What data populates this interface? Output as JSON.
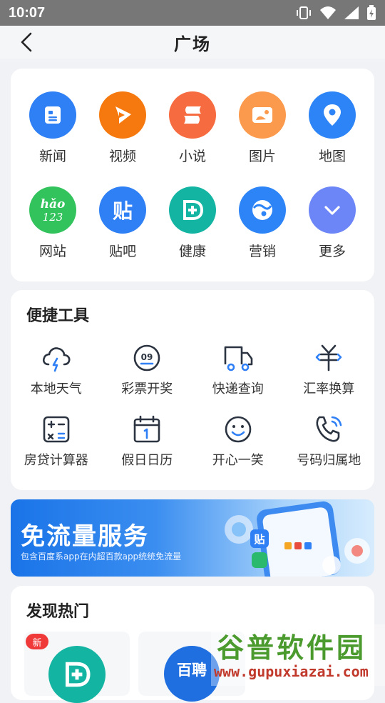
{
  "status_bar": {
    "time": "10:07"
  },
  "header": {
    "title": "广场"
  },
  "apps": [
    {
      "label": "新闻",
      "icon": "news-icon",
      "color": "#2f7ff5"
    },
    {
      "label": "视频",
      "icon": "video-play-icon",
      "color": "#f5790e"
    },
    {
      "label": "小说",
      "icon": "novel-icon",
      "color": "#f66b3f"
    },
    {
      "label": "图片",
      "icon": "image-icon",
      "color": "#fb9a4c"
    },
    {
      "label": "地图",
      "icon": "map-pin-icon",
      "color": "#2d84f6"
    },
    {
      "label": "网站",
      "icon": "hao123-icon",
      "color": "#33c35d"
    },
    {
      "label": "贴吧",
      "icon": "tieba-icon",
      "color": "#2f7ff5"
    },
    {
      "label": "健康",
      "icon": "health-icon",
      "color": "#13b4a2"
    },
    {
      "label": "营销",
      "icon": "marketing-icon",
      "color": "#2d84f6"
    },
    {
      "label": "更多",
      "icon": "chevron-down-icon",
      "color": "#6d86f7"
    }
  ],
  "tools": {
    "title": "便捷工具",
    "items": [
      {
        "label": "本地天气",
        "icon": "weather-icon"
      },
      {
        "label": "彩票开奖",
        "icon": "lottery-icon"
      },
      {
        "label": "快递查询",
        "icon": "delivery-truck-icon"
      },
      {
        "label": "汇率换算",
        "icon": "currency-exchange-icon"
      },
      {
        "label": "房贷计算器",
        "icon": "calculator-icon"
      },
      {
        "label": "假日日历",
        "icon": "calendar-icon"
      },
      {
        "label": "开心一笑",
        "icon": "smile-icon"
      },
      {
        "label": "号码归属地",
        "icon": "phone-icon"
      }
    ]
  },
  "banner": {
    "title": "免流量服务",
    "subtitle": "包含百度系app在内超百款app统统免流量"
  },
  "hot": {
    "title": "发现热门",
    "badge": "新",
    "card2_text": "百聘"
  },
  "watermark": {
    "line1": "谷普软件园",
    "line2": "www.gupuxiazai.com"
  },
  "colors": {
    "accent": "#2f7ff5",
    "icon_stroke": "#2b3440",
    "icon_accent": "#2f7ff5"
  }
}
